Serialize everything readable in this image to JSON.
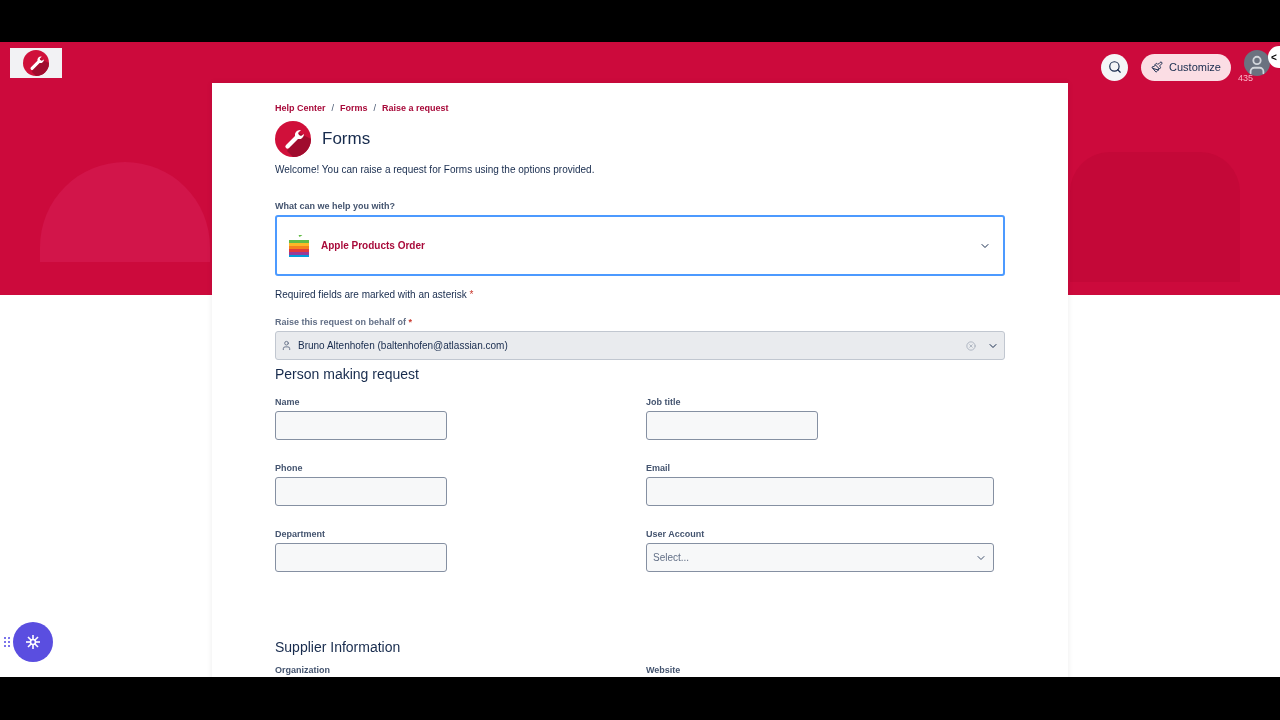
{
  "header": {
    "customize_label": "Customize",
    "badge_count": "435",
    "collapse_glyph": "<"
  },
  "breadcrumbs": [
    "Help Center",
    "Forms",
    "Raise a request"
  ],
  "breadcrumb_separators": [
    "/",
    "/"
  ],
  "title": "Forms",
  "welcome": "Welcome! You can raise a request for Forms using the options provided.",
  "request_type": {
    "label": "What can we help you with?",
    "value": "Apple Products Order"
  },
  "required_note": "Required fields are marked with an asterisk",
  "required_note_mark": "*",
  "on_behalf": {
    "label": "Raise this request on behalf of",
    "required_mark": "*",
    "value": "Bruno Altenhofen (baltenhofen@atlassian.com)"
  },
  "sections": [
    {
      "title": "Person making request",
      "fields": [
        {
          "label": "Name",
          "kind": "short-text"
        },
        {
          "label": "Job title",
          "kind": "short-text"
        },
        {
          "label": "Phone",
          "kind": "short-text"
        },
        {
          "label": "Email",
          "kind": "long-text"
        },
        {
          "label": "Department",
          "kind": "short-text"
        },
        {
          "label": "User Account",
          "kind": "select",
          "placeholder": "Select..."
        }
      ]
    },
    {
      "title": "Supplier Information",
      "fields": [
        {
          "label": "Organization",
          "kind": "label-only"
        },
        {
          "label": "Website",
          "kind": "label-only"
        }
      ]
    }
  ]
}
